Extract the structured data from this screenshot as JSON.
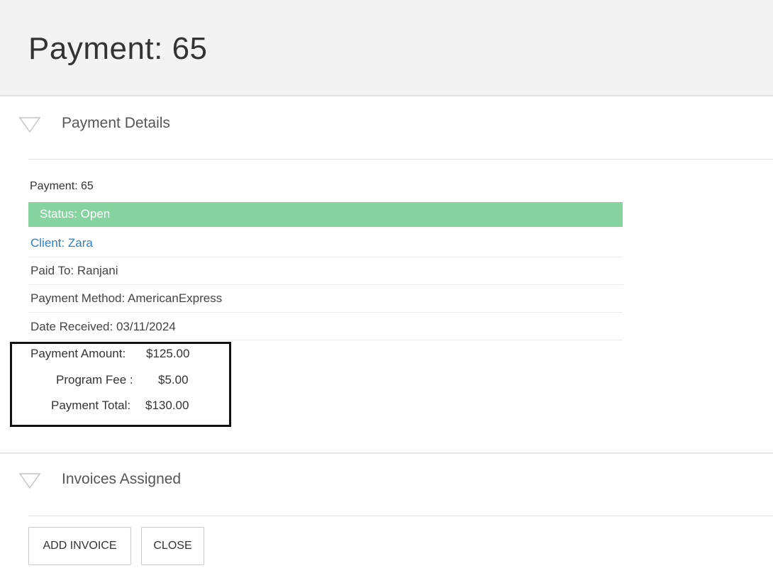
{
  "header": {
    "title": "Payment: 65"
  },
  "payment_details": {
    "section_title": "Payment Details",
    "payment_label": "Payment: 65",
    "status": "Status: Open",
    "client": "Client: Zara",
    "paid_to": "Paid To: Ranjani",
    "payment_method": "Payment Method: AmericanExpress",
    "date_received": "Date Received: 03/11/2024",
    "payment_amount": "Payment Amount:",
    "payment_amount_value": "$125.00",
    "program_fee": "Program Fee :",
    "program_fee_value": "$5.00",
    "payment_total": "Payment Total:",
    "payment_total_value": "$130.00"
  },
  "invoices": {
    "section_title": "Invoices Assigned",
    "add_invoice_label": "ADD INVOICE",
    "close_label": "CLOSE"
  },
  "colors": {
    "status_open": "#86d3a0",
    "link": "#2b7fc3"
  }
}
